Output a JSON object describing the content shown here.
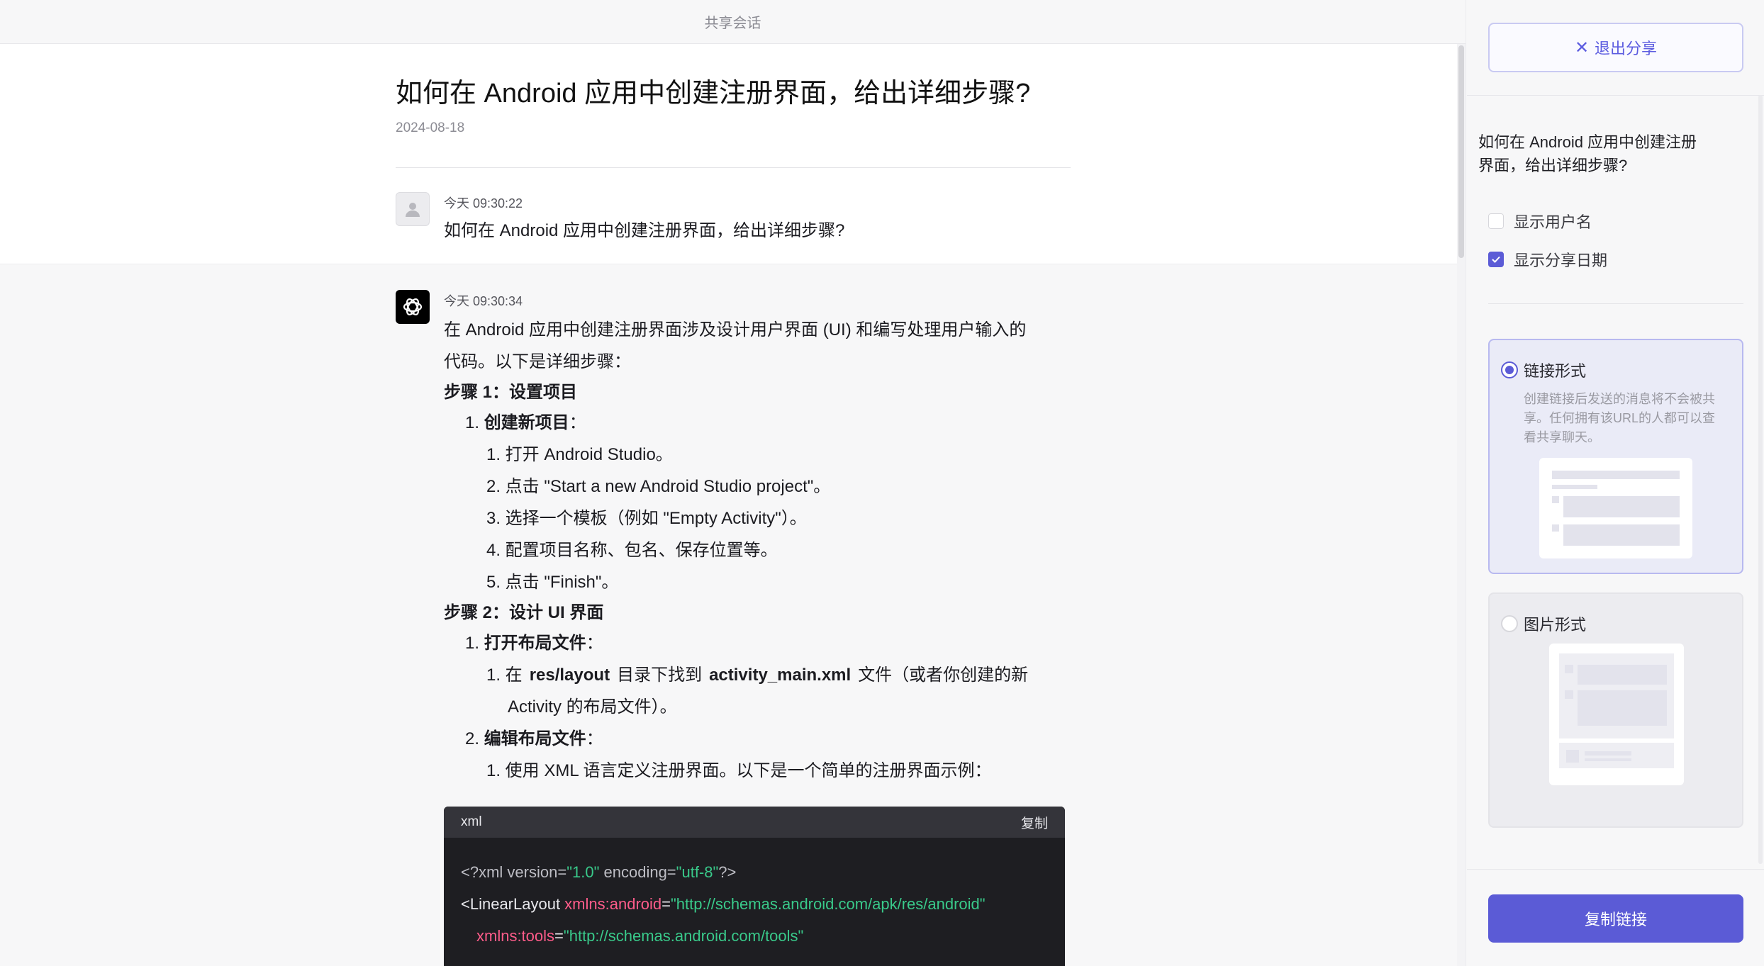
{
  "header": {
    "title": "共享会话"
  },
  "conversation": {
    "title": "如何在 Android 应用中创建注册界面，给出详细步骤?",
    "date": "2024-08-18",
    "user_message": {
      "time": "今天 09:30:22",
      "text": "如何在 Android 应用中创建注册界面，给出详细步骤?"
    },
    "ai_message": {
      "time": "今天 09:30:34",
      "intro_line1": "在 Android 应用中创建注册界面涉及设计用户界面 (UI) 和编写处理用户输入的",
      "intro_line2": "代码。以下是详细步骤：",
      "step1_heading": "步骤 1：设置项目",
      "step1_item1_label": "1. ",
      "step1_item1_bold": "创建新项目",
      "step1_item1_suffix": "：",
      "step1_sub": [
        "1. 打开 Android Studio。",
        "2. 点击 \"Start a new Android Studio project\"。",
        "3. 选择一个模板（例如 \"Empty Activity\"）。",
        "4. 配置项目名称、包名、保存位置等。",
        "5. 点击 \"Finish\"。"
      ],
      "step2_heading": "步骤 2：设计 UI 界面",
      "step2_item1_label": "1. ",
      "step2_item1_bold": "打开布局文件",
      "step2_item1_suffix": "：",
      "step2_item1_sub_prefix": "1. 在",
      "step2_item1_sub_code1": "res/layout",
      "step2_item1_sub_mid": "目录下找到",
      "step2_item1_sub_code2": "activity_main.xml",
      "step2_item1_sub_suffix": "文件（或者你创建的新 Activity 的布局文件）。",
      "step2_item2_label": "2. ",
      "step2_item2_bold": "编辑布局文件",
      "step2_item2_suffix": "：",
      "step2_item2_sub": "1. 使用 XML 语言定义注册界面。以下是一个简单的注册界面示例："
    },
    "code": {
      "language": "xml",
      "copy_label": "复制",
      "line1_a": "<?xml version=",
      "line1_b": "\"1.0\"",
      "line1_c": " encoding=",
      "line1_d": "\"utf-8\"",
      "line1_e": "?>",
      "line2_a": "<LinearLayout ",
      "line2_b": "xmlns:android",
      "line2_c": "=",
      "line2_d": "\"http://schemas.android.com/apk/res/android\"",
      "line3_b": "xmlns:tools",
      "line3_c": "=",
      "line3_d": "\"http://schemas.android.com/tools\""
    }
  },
  "share_panel": {
    "exit_label": "退出分享",
    "question": "如何在 Android 应用中创建注册界面，给出详细步骤?",
    "show_username_label": "显示用户名",
    "show_username_checked": false,
    "show_date_label": "显示分享日期",
    "show_date_checked": true,
    "link_option_label": "链接形式",
    "link_option_desc": "创建链接后发送的消息将不会被共享。任何拥有该URL的人都可以查看共享聊天。",
    "image_option_label": "图片形式",
    "selected_option": "链接形式",
    "copy_link_label": "复制链接",
    "accent_color": "#5b5bd6"
  }
}
